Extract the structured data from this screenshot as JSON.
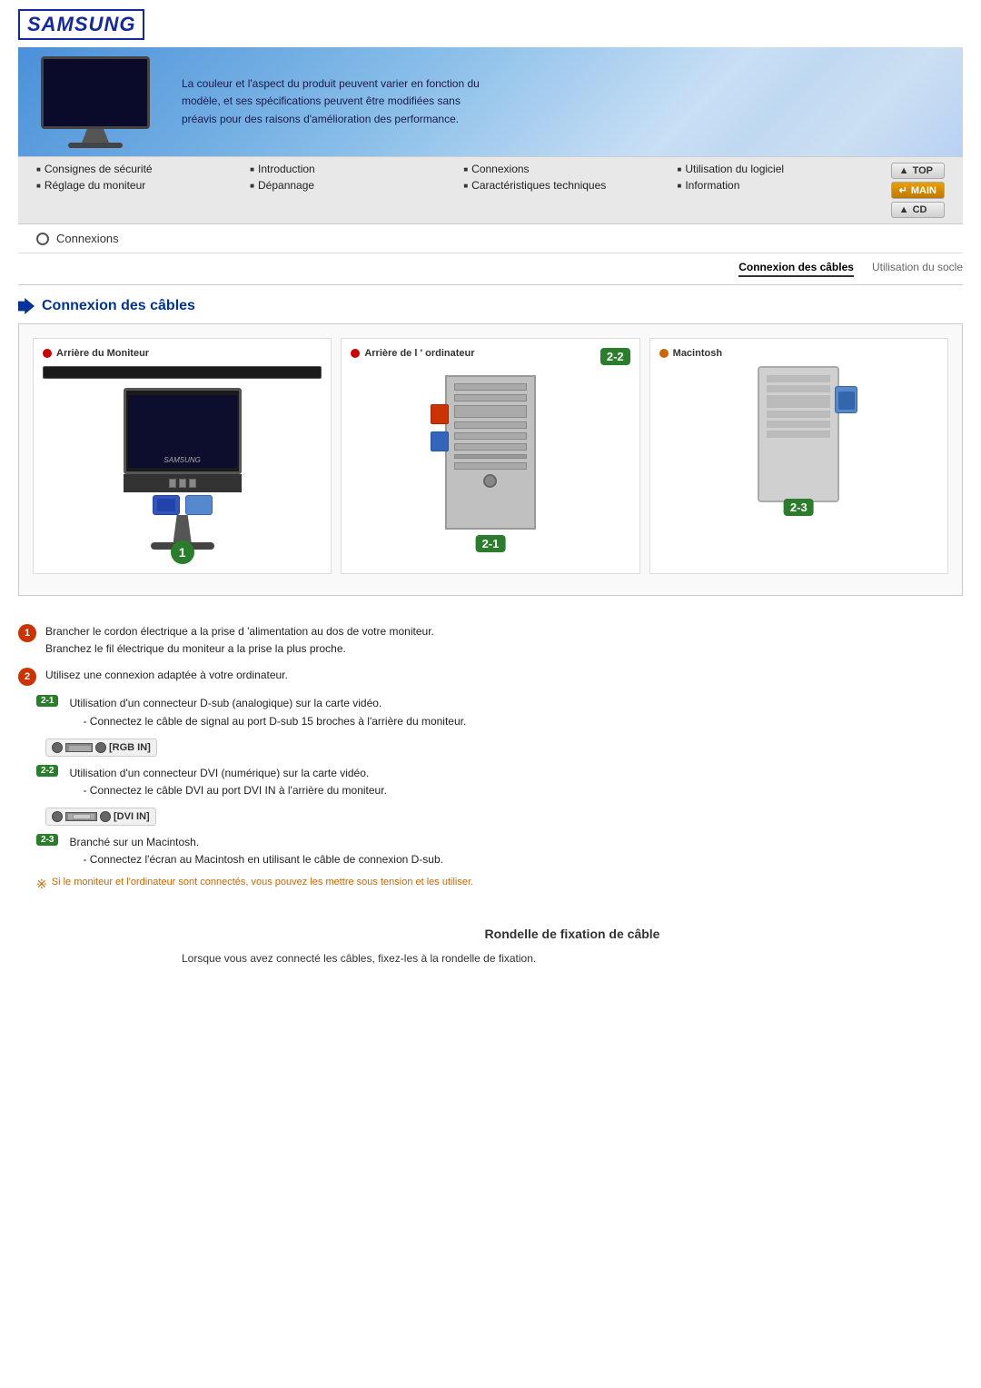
{
  "header": {
    "logo": "SAMSUNG",
    "banner_text": "La couleur et l'aspect du produit peuvent varier en fonction du modèle, et ses spécifications peuvent être modifiées sans préavis pour des raisons d'amélioration des performance."
  },
  "nav": {
    "items": [
      {
        "label": "Consignes de sécurité",
        "row": 0,
        "col": 0
      },
      {
        "label": "Introduction",
        "row": 0,
        "col": 1
      },
      {
        "label": "Connexions",
        "row": 0,
        "col": 2
      },
      {
        "label": "Utilisation du logiciel",
        "row": 0,
        "col": 3
      },
      {
        "label": "Réglage du moniteur",
        "row": 1,
        "col": 0
      },
      {
        "label": "Dépannage",
        "row": 1,
        "col": 1
      },
      {
        "label": "Caractéristiques techniques",
        "row": 1,
        "col": 2
      },
      {
        "label": "Information",
        "row": 1,
        "col": 3
      }
    ],
    "btn_top": "TOP",
    "btn_main": "MAIN",
    "btn_cd": "CD"
  },
  "breadcrumb": {
    "text": "Connexions"
  },
  "tabs": {
    "active": "Connexion des câbles",
    "inactive": "Utilisation du socle"
  },
  "section": {
    "title": "Connexion des câbles"
  },
  "diagram": {
    "col1_label": "Arrière du Moniteur",
    "col2_label": "Arrière de l ' ordinateur",
    "col3_label": "Macintosh",
    "badge1": "1",
    "badge21": "2-1",
    "badge22": "2-2",
    "badge23": "2-3"
  },
  "instructions": [
    {
      "num": "1",
      "text1": "Brancher le cordon électrique a la prise d 'alimentation au dos de votre moniteur.",
      "text2": "Branchez le fil électrique du moniteur a la prise la plus proche."
    },
    {
      "num": "2",
      "text1": "Utilisez une connexion adaptée à votre ordinateur."
    }
  ],
  "sub_instructions": [
    {
      "badge": "2-1",
      "text1": "Utilisation d'un connecteur D-sub (analogique) sur la carte vidéo.",
      "text2": "- Connectez le câble de signal au port D-sub 15 broches à l'arrière du moniteur."
    },
    {
      "badge": "2-2",
      "port_label": "[RGB IN]",
      "text1": "Utilisation d'un connecteur DVI (numérique) sur la carte vidéo.",
      "text2": "- Connectez le câble DVI au port DVI IN à l'arrière du moniteur."
    },
    {
      "badge": "2-3",
      "port_label": "[DVI IN]",
      "text1": "Branché sur un Macintosh.",
      "text2": "- Connectez l'écran au Macintosh en utilisant le câble de connexion D-sub."
    }
  ],
  "note": {
    "symbol": "※",
    "text": "Si le moniteur et l'ordinateur sont connectés, vous pouvez les mettre sous tension et les utiliser."
  },
  "rondelle": {
    "title": "Rondelle de fixation de câble",
    "text": "Lorsque vous avez connecté les câbles, fixez-les à la rondelle de fixation."
  }
}
